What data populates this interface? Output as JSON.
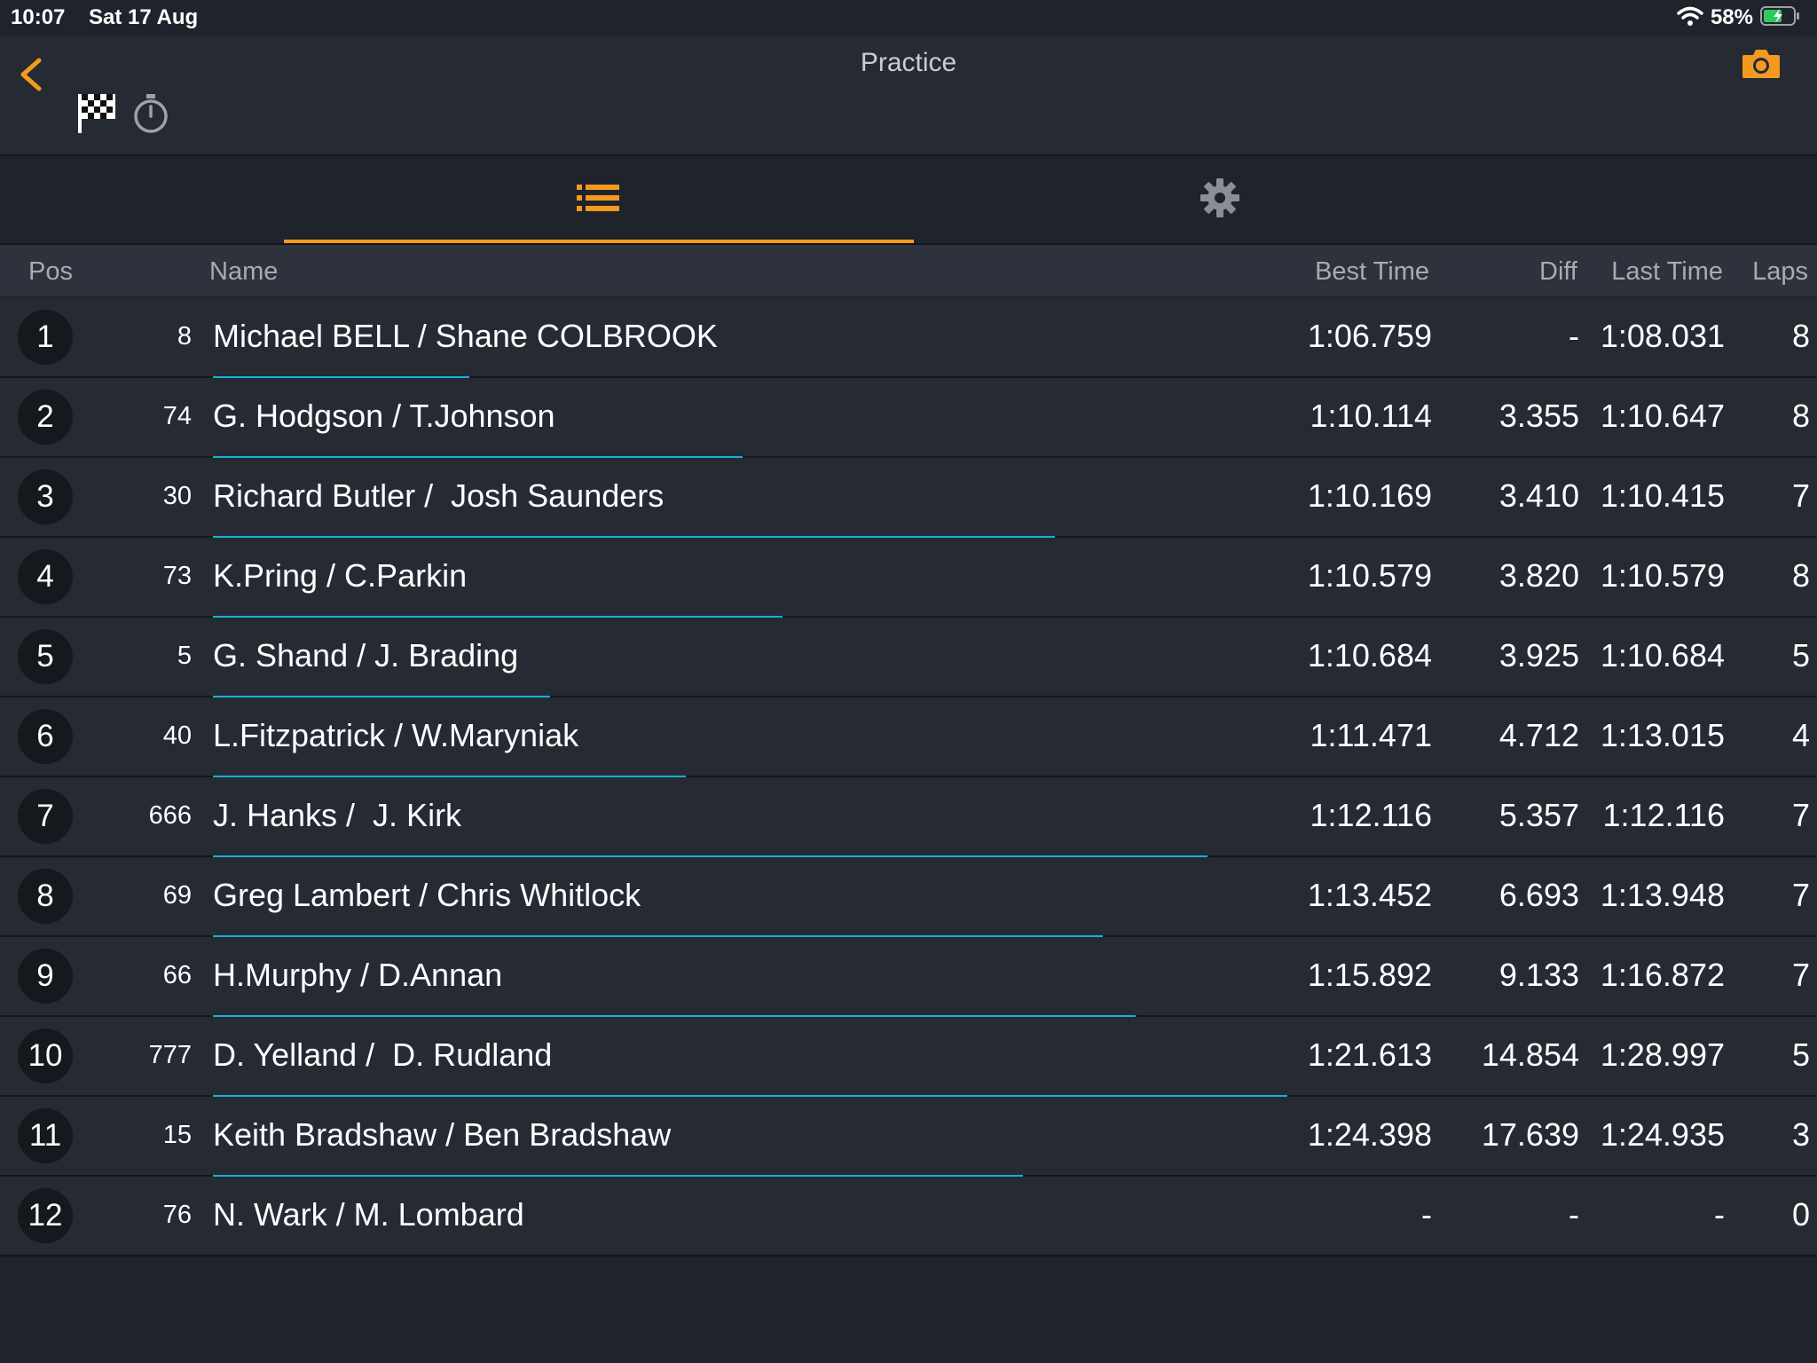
{
  "status": {
    "time": "10:07",
    "date": "Sat 17 Aug",
    "battery": "58%"
  },
  "nav": {
    "title": "Practice"
  },
  "colors": {
    "accent": "#f39a1f",
    "progress": "#13b3d3"
  },
  "icons": [
    "back-icon",
    "checkered-flag-icon",
    "stopwatch-icon",
    "camera-icon",
    "list-icon",
    "gear-icon",
    "wifi-icon",
    "battery-icon"
  ],
  "table": {
    "headers": {
      "pos": "Pos",
      "name": "Name",
      "best": "Best Time",
      "diff": "Diff",
      "last": "Last Time",
      "laps": "Laps"
    },
    "rows": [
      {
        "pos": "1",
        "num": "8",
        "name": "Michael BELL / Shane COLBROOK",
        "best": "1:06.759",
        "diff": "-",
        "last": "1:08.031",
        "laps": "8",
        "progress": 0.16
      },
      {
        "pos": "2",
        "num": "74",
        "name": "G. Hodgson / T.Johnson",
        "best": "1:10.114",
        "diff": "3.355",
        "last": "1:10.647",
        "laps": "8",
        "progress": 0.33
      },
      {
        "pos": "3",
        "num": "30",
        "name": "Richard Butler /  Josh Saunders",
        "best": "1:10.169",
        "diff": "3.410",
        "last": "1:10.415",
        "laps": "7",
        "progress": 0.525
      },
      {
        "pos": "4",
        "num": "73",
        "name": "K.Pring / C.Parkin",
        "best": "1:10.579",
        "diff": "3.820",
        "last": "1:10.579",
        "laps": "8",
        "progress": 0.355
      },
      {
        "pos": "5",
        "num": "5",
        "name": "G. Shand / J. Brading",
        "best": "1:10.684",
        "diff": "3.925",
        "last": "1:10.684",
        "laps": "5",
        "progress": 0.21
      },
      {
        "pos": "6",
        "num": "40",
        "name": "L.Fitzpatrick / W.Maryniak",
        "best": "1:11.471",
        "diff": "4.712",
        "last": "1:13.015",
        "laps": "4",
        "progress": 0.295
      },
      {
        "pos": "7",
        "num": "666",
        "name": "J. Hanks /  J. Kirk",
        "best": "1:12.116",
        "diff": "5.357",
        "last": "1:12.116",
        "laps": "7",
        "progress": 0.62
      },
      {
        "pos": "8",
        "num": "69",
        "name": "Greg Lambert / Chris Whitlock",
        "best": "1:13.452",
        "diff": "6.693",
        "last": "1:13.948",
        "laps": "7",
        "progress": 0.555
      },
      {
        "pos": "9",
        "num": "66",
        "name": "H.Murphy / D.Annan",
        "best": "1:15.892",
        "diff": "9.133",
        "last": "1:16.872",
        "laps": "7",
        "progress": 0.575
      },
      {
        "pos": "10",
        "num": "777",
        "name": "D. Yelland /  D. Rudland",
        "best": "1:21.613",
        "diff": "14.854",
        "last": "1:28.997",
        "laps": "5",
        "progress": 0.67
      },
      {
        "pos": "11",
        "num": "15",
        "name": "Keith Bradshaw / Ben Bradshaw",
        "best": "1:24.398",
        "diff": "17.639",
        "last": "1:24.935",
        "laps": "3",
        "progress": 0.505
      },
      {
        "pos": "12",
        "num": "76",
        "name": "N. Wark / M. Lombard",
        "best": "-",
        "diff": "-",
        "last": "-",
        "laps": "0",
        "progress": 0
      }
    ]
  }
}
